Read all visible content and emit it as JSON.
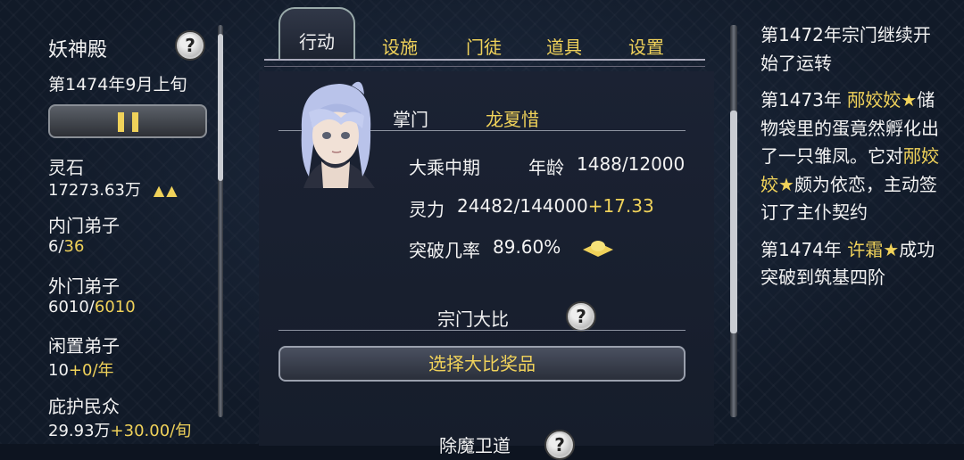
{
  "sidebar": {
    "sect_name": "妖神殿",
    "help_glyph": "?",
    "date": "第1474年9月上旬",
    "stats": [
      {
        "label": "灵石",
        "value": "17273.63万",
        "extra": "▲▲"
      },
      {
        "label": "内门弟子",
        "value_a": "6/",
        "value_b": "36"
      },
      {
        "label": "外门弟子",
        "value_a": "6010/",
        "value_b": "6010"
      },
      {
        "label": "闲置弟子",
        "value_a": "10",
        "value_b": "+0/年"
      },
      {
        "label": "庇护民众",
        "value_a": "29.93万",
        "value_b": "+30.00/旬"
      }
    ]
  },
  "tabs": {
    "active": "行动",
    "items": [
      "设施",
      "门徒",
      "道具",
      "设置"
    ]
  },
  "leader": {
    "title": "掌门",
    "name": "龙夏惜",
    "realm": "大乘中期",
    "age_label": "年龄",
    "age_value": "1488/12000",
    "spirit_label": "灵力",
    "spirit_value": "24482/144000",
    "spirit_rate": "+17.33",
    "breakthrough_label": "突破几率",
    "breakthrough_value": "89.60%"
  },
  "tournament": {
    "title": "宗门大比",
    "button": "选择大比奖品"
  },
  "next_section": {
    "title": "除魔卫道"
  },
  "log": [
    {
      "parts": [
        {
          "t": "第1472年"
        },
        {
          "t": "宗门继续开始了运转"
        }
      ]
    },
    {
      "parts": [
        {
          "t": "第1473年 "
        },
        {
          "t": "邴姣姣★",
          "hl": true
        },
        {
          "t": "储物袋里的蛋竟然孵化出了一只雏凤。它对"
        },
        {
          "t": "邴姣姣★",
          "hl": true
        },
        {
          "t": "颇为依恋，主动签订了主仆契约"
        }
      ]
    },
    {
      "parts": [
        {
          "t": "第1474年 "
        },
        {
          "t": "许霜★",
          "hl": true
        },
        {
          "t": "成功突破到筑基四阶"
        }
      ]
    }
  ],
  "colors": {
    "accent": "#f0d25a",
    "text": "#f2f2f2",
    "background": "#111a28"
  }
}
